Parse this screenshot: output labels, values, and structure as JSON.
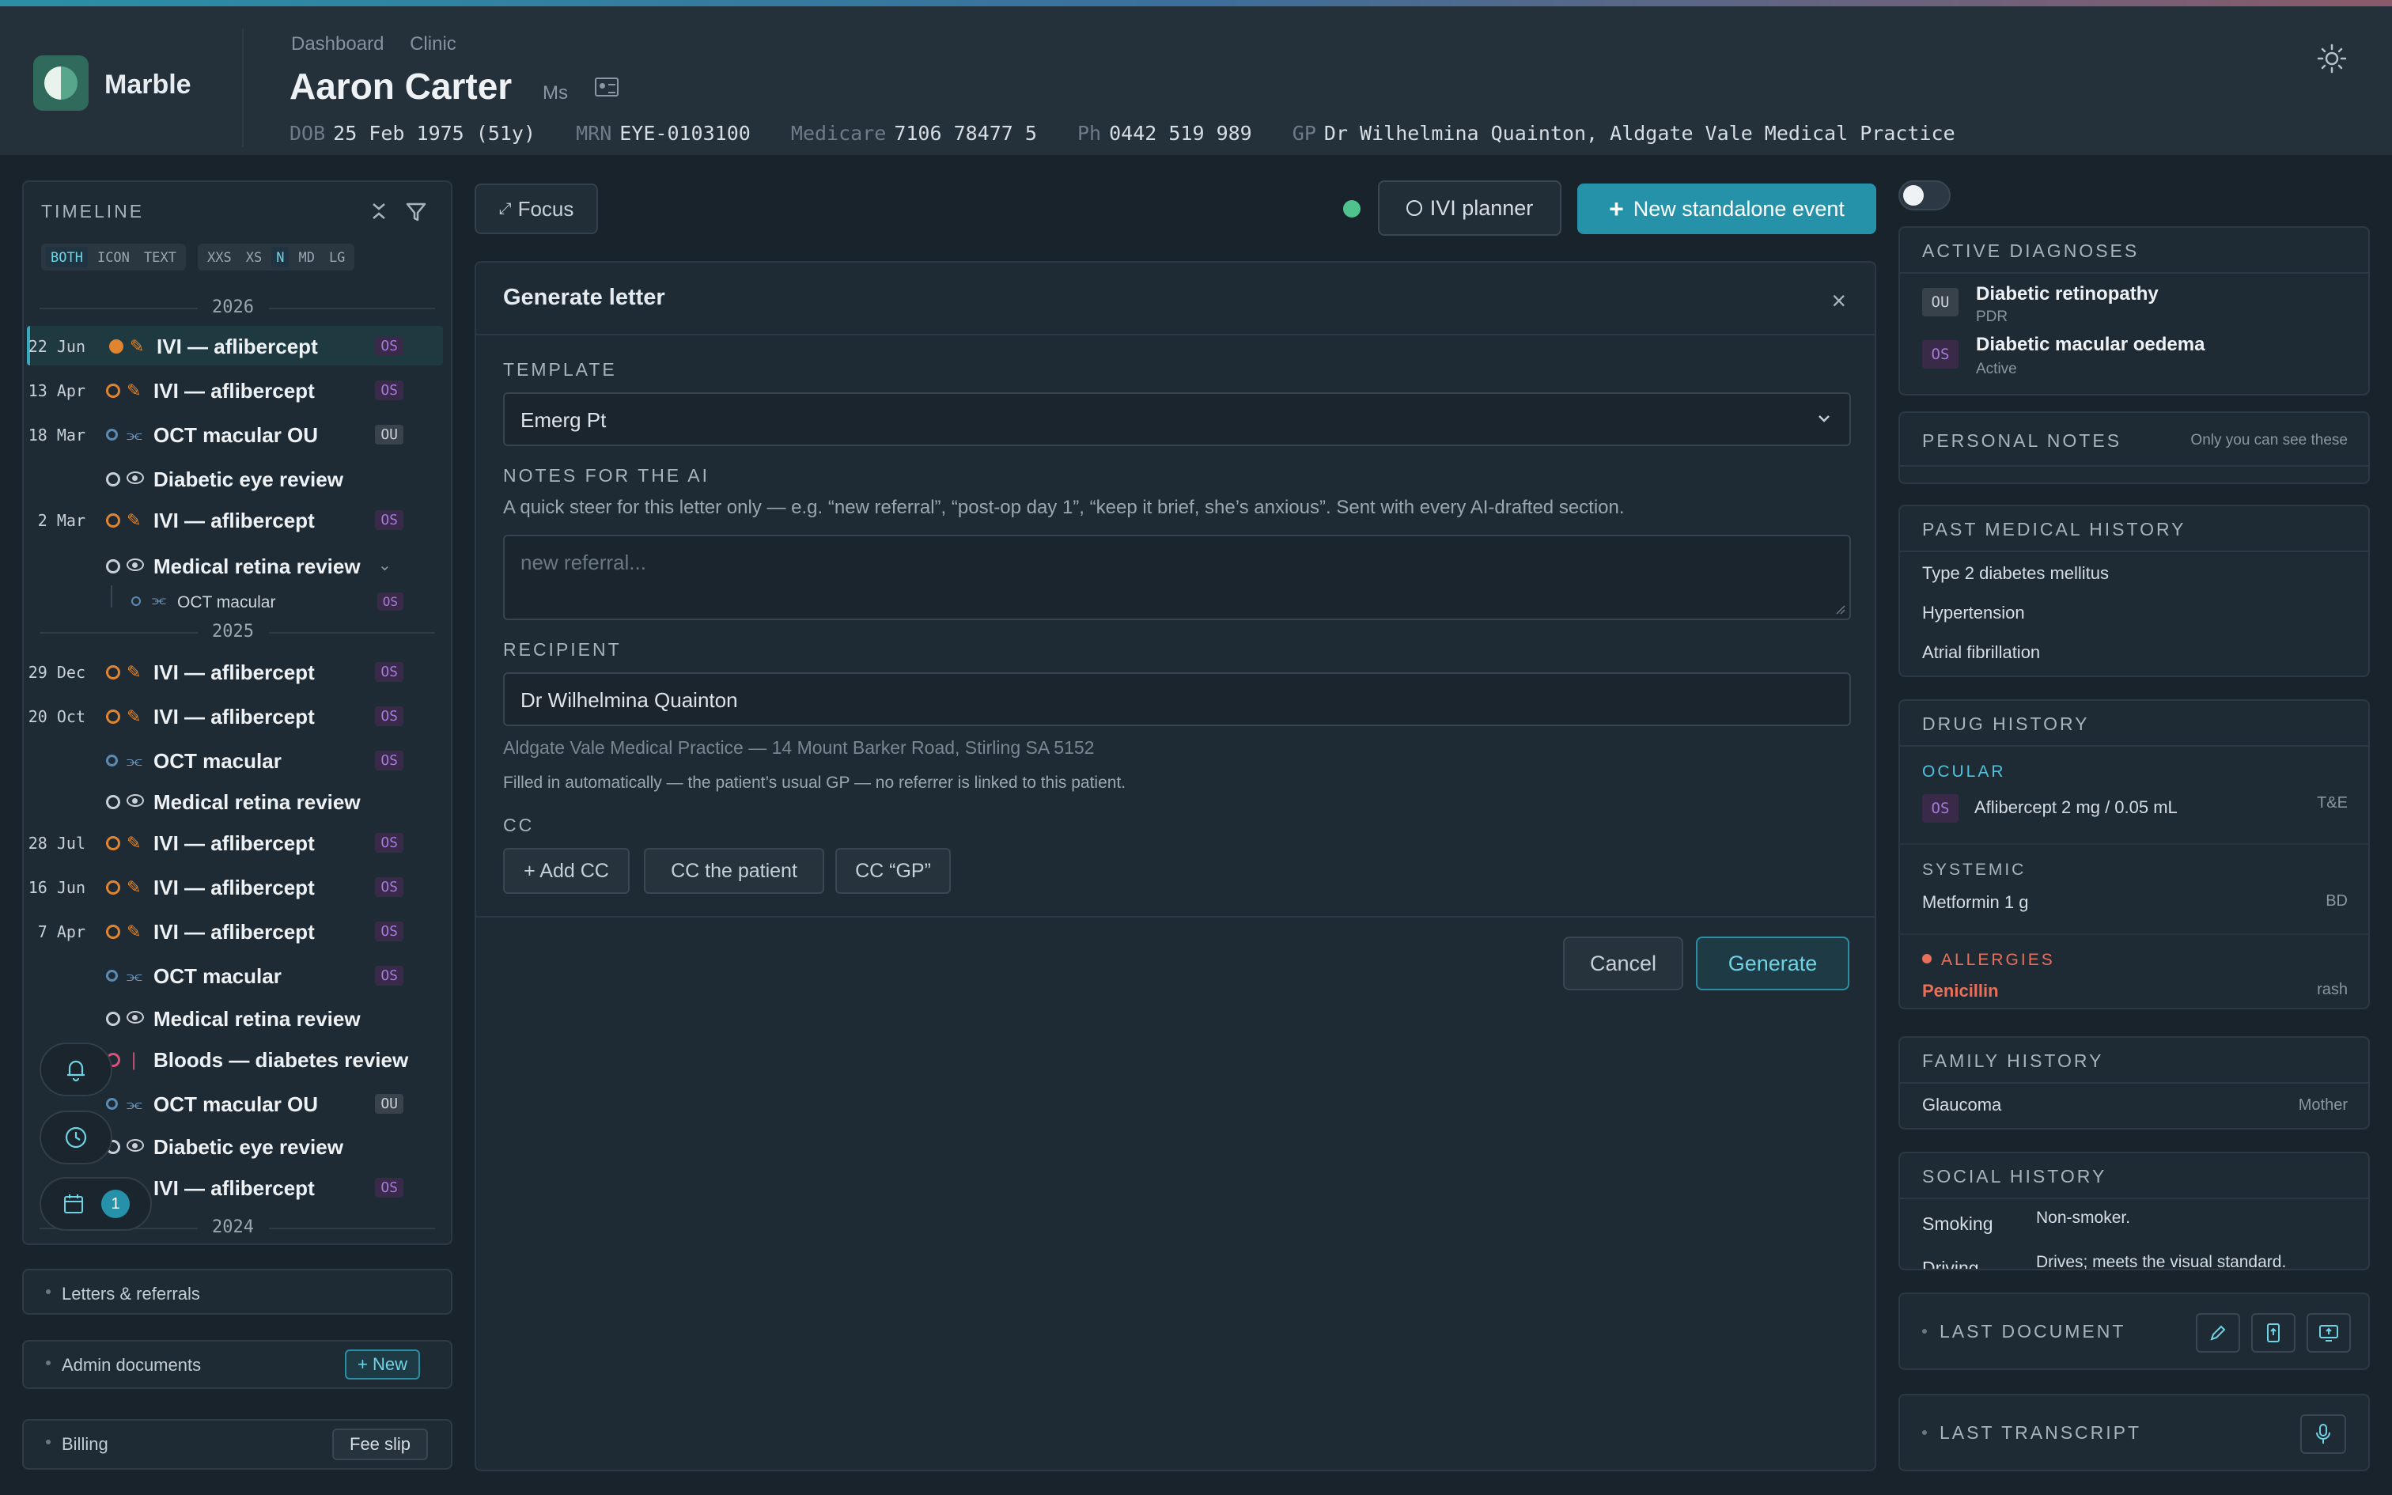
{
  "app": {
    "name": "Marble"
  },
  "header": {
    "breadcrumbs": [
      "Dashboard",
      "Clinic"
    ],
    "patient_name": "Aaron Carter",
    "patient_title": "Ms",
    "info": {
      "dob_label": "DOB",
      "dob": "25 Feb 1975 (51y)",
      "mrn_label": "MRN",
      "mrn": "EYE-0103100",
      "medicare_label": "Medicare",
      "medicare": "7106 78477 5",
      "ph_label": "Ph",
      "ph": "0442 519 989",
      "gp_label": "GP",
      "gp": "Dr Wilhelmina Quainton, Aldgate Vale Medical Practice"
    }
  },
  "timeline": {
    "title": "TIMELINE",
    "mode_chips": [
      "BOTH",
      "ICON",
      "TEXT"
    ],
    "size_chips": [
      "XXS",
      "XS",
      "N",
      "MD",
      "LG"
    ],
    "years": [
      "2026",
      "2025",
      "2024"
    ],
    "events": [
      {
        "date": "22 Jun",
        "label": "IVI — aflibercept",
        "eye": "OS"
      },
      {
        "date": "13 Apr",
        "label": "IVI — aflibercept",
        "eye": "OS"
      },
      {
        "date": "18 Mar",
        "label": "OCT macular OU",
        "eye": "OU"
      },
      {
        "date": "",
        "label": "Diabetic eye review",
        "eye": ""
      },
      {
        "date": "2 Mar",
        "label": "IVI — aflibercept",
        "eye": "OS"
      },
      {
        "date": "",
        "label": "Medical retina review",
        "eye": ""
      },
      {
        "date": "",
        "label": "OCT macular",
        "eye": "OS"
      },
      {
        "date": "29 Dec",
        "label": "IVI — aflibercept",
        "eye": "OS"
      },
      {
        "date": "20 Oct",
        "label": "IVI — aflibercept",
        "eye": "OS"
      },
      {
        "date": "",
        "label": "OCT macular",
        "eye": "OS"
      },
      {
        "date": "",
        "label": "Medical retina review",
        "eye": ""
      },
      {
        "date": "28 Jul",
        "label": "IVI — aflibercept",
        "eye": "OS"
      },
      {
        "date": "16 Jun",
        "label": "IVI — aflibercept",
        "eye": "OS"
      },
      {
        "date": "7 Apr",
        "label": "IVI — aflibercept",
        "eye": "OS"
      },
      {
        "date": "",
        "label": "OCT macular",
        "eye": "OS"
      },
      {
        "date": "",
        "label": "Medical retina review",
        "eye": ""
      },
      {
        "date": "",
        "label": "Bloods — diabetes review",
        "eye": ""
      },
      {
        "date": "",
        "label": "OCT macular OU",
        "eye": "OU"
      },
      {
        "date": "",
        "label": "Diabetic eye review",
        "eye": ""
      },
      {
        "date": "",
        "label": "IVI — aflibercept",
        "eye": "OS"
      }
    ],
    "calendar_count": "1"
  },
  "sections": {
    "letters": "Letters & referrals",
    "admin": "Admin documents",
    "admin_new": "+ New",
    "billing": "Billing",
    "fee_slip": "Fee slip"
  },
  "toolbar": {
    "focus": "Focus",
    "ivi_planner": "IVI planner",
    "new_event": "New standalone event"
  },
  "dialog": {
    "title": "Generate letter",
    "template_label": "TEMPLATE",
    "template_value": "Emerg Pt",
    "notes_label": "NOTES FOR THE AI",
    "notes_help": "A quick steer for this letter only — e.g. “new referral”, “post-op day 1”, “keep it brief, she’s anxious”. Sent with every AI-drafted section.",
    "notes_placeholder": "new referral...",
    "recipient_label": "RECIPIENT",
    "recipient_value": "Dr Wilhelmina Quainton",
    "recipient_address": "Aldgate Vale Medical Practice — 14 Mount Barker Road, Stirling SA 5152",
    "recipient_note": "Filled in automatically — the patient’s usual GP — no referrer is linked to this patient.",
    "cc_label": "CC",
    "cc_buttons": [
      "+ Add CC",
      "CC the patient",
      "CC “GP”"
    ],
    "cancel": "Cancel",
    "generate": "Generate"
  },
  "right": {
    "active_diagnoses": {
      "title": "ACTIVE DIAGNOSES",
      "items": [
        {
          "eye": "OU",
          "name": "Diabetic retinopathy",
          "status": "PDR"
        },
        {
          "eye": "OS",
          "name": "Diabetic macular oedema",
          "status": "Active"
        }
      ]
    },
    "personal_notes": {
      "title": "PERSONAL NOTES",
      "note": "Only you can see these"
    },
    "past_medical": {
      "title": "PAST MEDICAL HISTORY",
      "items": [
        "Type 2 diabetes mellitus",
        "Hypertension",
        "Atrial fibrillation"
      ]
    },
    "drug_history": {
      "title": "DRUG HISTORY",
      "ocular_label": "OCULAR",
      "ocular": {
        "eye": "OS",
        "drug": "Aflibercept 2 mg / 0.05 mL",
        "freq": "T&E"
      },
      "systemic_label": "SYSTEMIC",
      "systemic": {
        "drug": "Metformin 1 g",
        "freq": "BD"
      },
      "allergies_label": "ALLERGIES",
      "allergy": {
        "name": "Penicillin",
        "reaction": "rash"
      }
    },
    "family_history": {
      "title": "FAMILY HISTORY",
      "condition": "Glaucoma",
      "relation": "Mother"
    },
    "social_history": {
      "title": "SOCIAL HISTORY",
      "rows": [
        {
          "label": "Smoking",
          "value": "Non-smoker."
        },
        {
          "label": "Driving",
          "value": "Drives; meets the visual standard."
        }
      ]
    },
    "last_document": "LAST DOCUMENT",
    "last_transcript": "LAST TRANSCRIPT"
  },
  "colors": {
    "accent": "#2692aa",
    "os": "#a57ad8",
    "ivi": "#e0842f",
    "allergy": "#e8705a",
    "ocular": "#4fc3d9"
  }
}
